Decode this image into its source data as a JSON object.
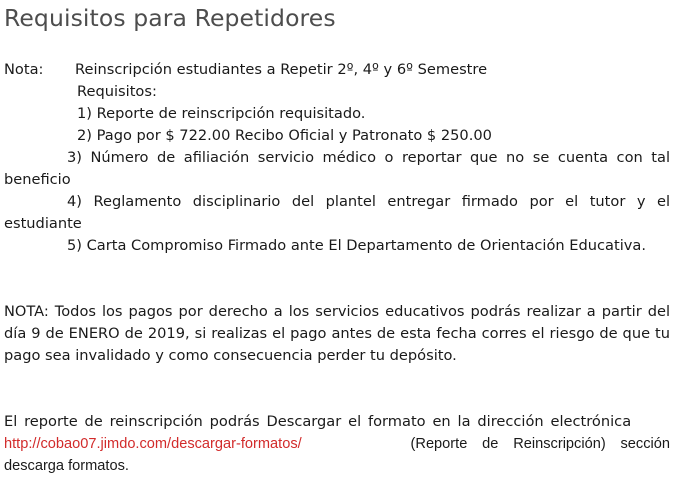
{
  "title": "Requisitos para Repetidores",
  "nota": {
    "label": "Nota:",
    "heading": "Reinscripción estudiantes a Repetir 2º, 4º y 6º Semestre",
    "requisitos_label": "Requisitos:",
    "items": [
      "1) Reporte de reinscripción requisitado.",
      "2) Pago por $ 722.00 Recibo Oficial y Patronato $ 250.00",
      "3) Número de afiliación servicio médico o reportar que no se cuenta con tal beneficio",
      "4) Reglamento disciplinario del plantel entregar firmado por el tutor y el estudiante",
      "5) Carta Compromiso Firmado ante El Departamento de Orientación Educativa."
    ]
  },
  "payment_note": "NOTA: Todos los pagos por derecho a los servicios educativos podrás realizar a partir del día 9 de ENERO de 2019, si realizas el pago antes de esta fecha corres el riesgo de que tu pago sea invalidado y como consecuencia perder tu depósito.",
  "download": {
    "text_before": "El reporte de reinscripción podrás Descargar el formato en la dirección electrónica",
    "link": "http://cobao07.jimdo.com/descargar-formatos/",
    "text_after": "(Reporte de Reinscripción) sección descarga formatos."
  }
}
